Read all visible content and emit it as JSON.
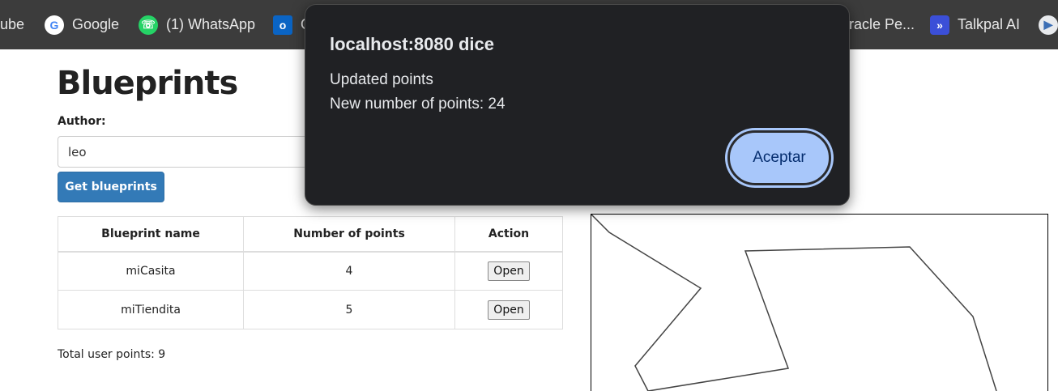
{
  "bookmarks": [
    {
      "label": "ube",
      "icon": "youtube-icon"
    },
    {
      "label": "Google",
      "icon": "google-icon"
    },
    {
      "label": "(1) WhatsApp",
      "icon": "whatsapp-icon"
    },
    {
      "label": "O",
      "icon": "outlook-icon"
    },
    {
      "label": "racle Pe...",
      "icon": ""
    },
    {
      "label": "Talkpal AI",
      "icon": "talkpal-icon"
    },
    {
      "label": "",
      "icon": "play-icon"
    }
  ],
  "page": {
    "title": "Blueprints",
    "author_label": "Author:",
    "author_value": "leo",
    "get_button": "Get blueprints",
    "table": {
      "headers": [
        "Blueprint name",
        "Number of points",
        "Action"
      ],
      "rows": [
        {
          "name": "miCasita",
          "points": "4",
          "action": "Open"
        },
        {
          "name": "miTiendita",
          "points": "5",
          "action": "Open"
        }
      ]
    },
    "total": "Total user points: 9"
  },
  "dialog": {
    "title": "localhost:8080 dice",
    "line1": "Updated points",
    "line2": "New number of points: 24",
    "accept": "Aceptar"
  },
  "colors": {
    "bookmark_bar": "#3c3c3c",
    "primary_button": "#337ab7",
    "dialog_bg": "#202124",
    "dialog_button": "#a8c7fa"
  }
}
